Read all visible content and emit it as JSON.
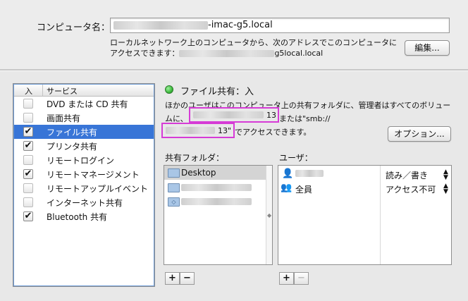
{
  "computer_name": {
    "label": "コンピュータ名：",
    "value_suffix": "-imac-g5.local",
    "desc_line1": "ローカルネットワーク上のコンピュータから、次のアドレスでこのコンピュータに",
    "desc_line2_prefix": "アクセスできます：",
    "address_suffix": "g5local.local",
    "edit_button": "編集..."
  },
  "services": {
    "col_on": "入",
    "col_service": "サービス",
    "items": [
      {
        "label": "DVD または CD 共有",
        "checked": false,
        "selected": false
      },
      {
        "label": "画面共有",
        "checked": false,
        "selected": false
      },
      {
        "label": "ファイル共有",
        "checked": true,
        "selected": true
      },
      {
        "label": "プリンタ共有",
        "checked": true,
        "selected": false
      },
      {
        "label": "リモートログイン",
        "checked": false,
        "selected": false
      },
      {
        "label": "リモートマネージメント",
        "checked": true,
        "selected": false
      },
      {
        "label": "リモートアップルイベント",
        "checked": false,
        "selected": false
      },
      {
        "label": "インターネット共有",
        "checked": false,
        "selected": false
      },
      {
        "label": "Bluetooth 共有",
        "checked": true,
        "selected": false
      }
    ]
  },
  "status": {
    "title": "ファイル共有：入",
    "indicator_color": "#3dbb3d",
    "desc_line1": "ほかのユーザはこのコンピュータ上の共有フォルダに、管理者はすべてのボリュー",
    "desc_line2_prefix": "ムに、",
    "addr1_suffix": "13",
    "desc_line2_mid": "または\"smb://",
    "addr2_suffix": "13\"",
    "desc_line3_suffix": "でアクセスできます。",
    "options_button": "オプション..."
  },
  "shared_folders": {
    "header": "共有フォルダ：",
    "items": [
      {
        "name": "Desktop",
        "icon": "folder-icon"
      },
      {
        "name": "",
        "icon": "folder-icon"
      },
      {
        "name": "",
        "icon": "public-folder-icon"
      }
    ]
  },
  "users": {
    "header": "ユーザ：",
    "items": [
      {
        "name": "",
        "icon": "user-icon",
        "permission": "読み／書き"
      },
      {
        "name": "全員",
        "icon": "group-icon",
        "permission": "アクセス不可"
      }
    ]
  },
  "controls": {
    "add": "+",
    "remove": "−"
  },
  "colors": {
    "selection": "#3875d7",
    "highlight_box": "#d63bd6"
  }
}
